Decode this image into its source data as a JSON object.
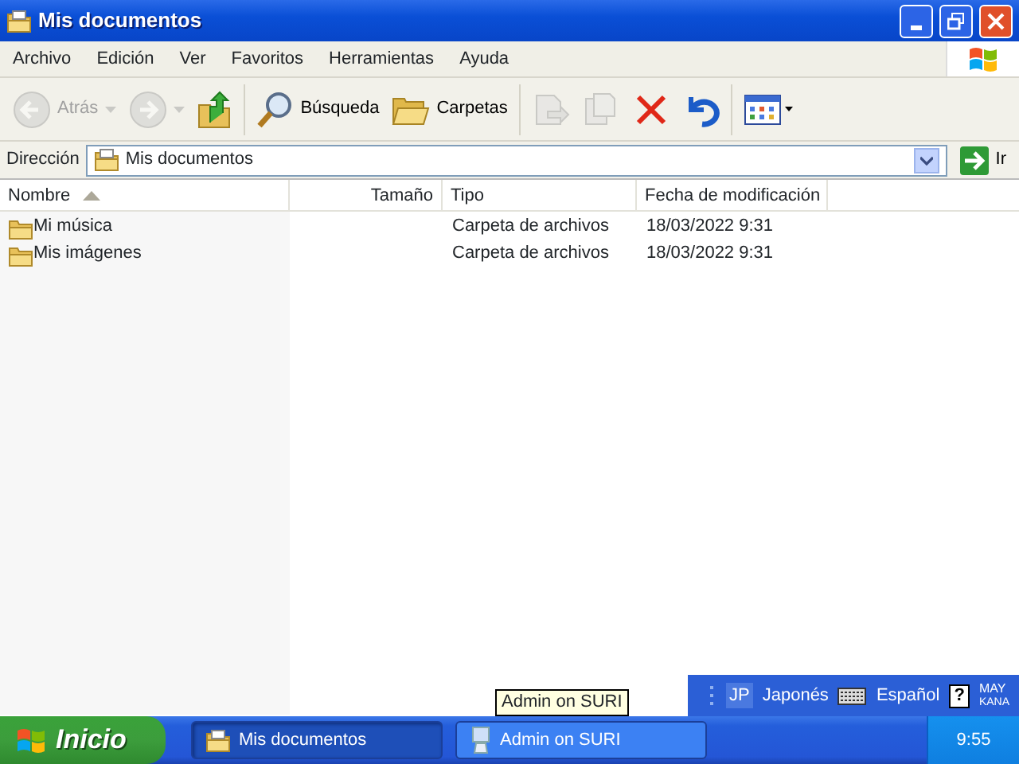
{
  "window": {
    "title": "Mis documentos"
  },
  "menu": [
    "Archivo",
    "Edición",
    "Ver",
    "Favoritos",
    "Herramientas",
    "Ayuda"
  ],
  "toolbar": [
    {
      "label": "Atrás",
      "disabled": true
    },
    {
      "disabled": true
    },
    {
      "disabled": false
    },
    {
      "label": "Búsqueda",
      "disabled": false
    },
    {
      "label": "Carpetas",
      "disabled": false
    },
    {
      "disabled": true
    },
    {
      "disabled": true
    },
    {
      "disabled": false
    },
    {
      "disabled": false
    },
    {
      "disabled": false
    }
  ],
  "address": {
    "label": "Dirección",
    "value": "Mis documentos",
    "go": "Ir"
  },
  "table": {
    "columns": [
      "Nombre",
      "Tamaño",
      "Tipo",
      "Fecha de modificación"
    ],
    "rows": [
      [
        "Mi música",
        "",
        "Carpeta de archivos",
        "18/03/2022 9:31"
      ],
      [
        "Mis imágenes",
        "",
        "Carpeta de archivos",
        "18/03/2022 9:31"
      ]
    ]
  },
  "language_bar": {
    "code": "JP",
    "input": "Japonés",
    "keyboard": "Español",
    "help": "?",
    "mode": "MAY",
    "kana": "KANA"
  },
  "tooltip": "Admin on SURI",
  "taskbar": {
    "start": "Inicio",
    "buttons": [
      {
        "label": "Mis documentos",
        "selected": true
      },
      {
        "label": "Admin on SURI",
        "selected": false
      }
    ],
    "clock": "9:55"
  }
}
